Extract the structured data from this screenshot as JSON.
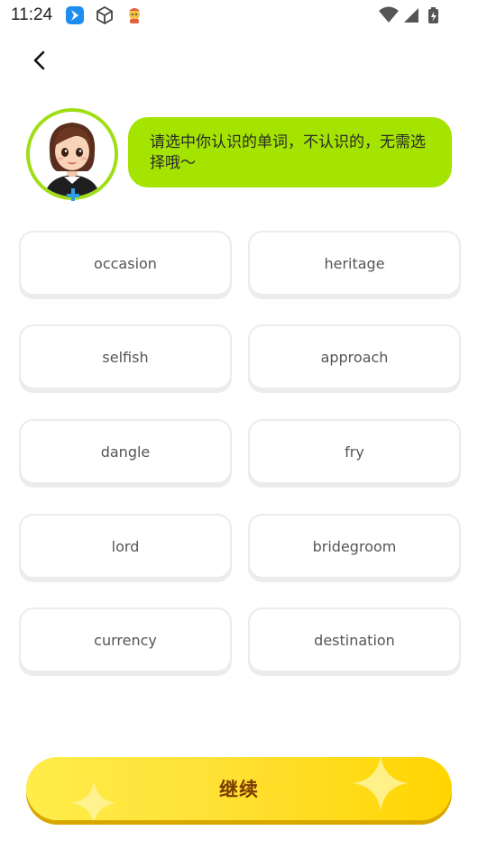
{
  "status_bar": {
    "time": "11:24",
    "icons": [
      "app-blue-icon",
      "cube-icon",
      "cartoon-app-icon",
      "wifi-icon",
      "signal-icon",
      "battery-icon"
    ]
  },
  "header": {
    "back_icon": "chevron-left-icon"
  },
  "prompt": {
    "message": "请选中你认识的单词，不认识的，无需选择哦～"
  },
  "words": [
    {
      "label": "occasion"
    },
    {
      "label": "heritage"
    },
    {
      "label": "selfish"
    },
    {
      "label": "approach"
    },
    {
      "label": "dangle"
    },
    {
      "label": "fry"
    },
    {
      "label": "lord"
    },
    {
      "label": "bridegroom"
    },
    {
      "label": "currency"
    },
    {
      "label": "destination"
    }
  ],
  "footer": {
    "continue_label": "继续"
  },
  "colors": {
    "accent_green": "#a4e400",
    "button_yellow": "#ffe136",
    "button_text": "#7a3b00"
  }
}
